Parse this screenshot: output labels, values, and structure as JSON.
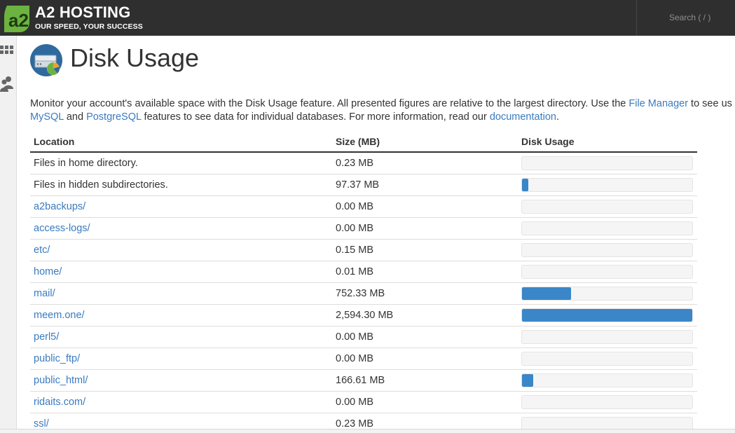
{
  "header": {
    "brand_mark": "a2",
    "brand_name": "A2 HOSTING",
    "tagline": "OUR SPEED, YOUR SUCCESS",
    "search_label": "Search ( / )",
    "brand_color": "#6cb33f"
  },
  "leftrail": {
    "items": [
      {
        "icon": "grid-icon"
      },
      {
        "icon": "users-icon"
      }
    ]
  },
  "page": {
    "icon": "disk-usage-icon",
    "title": "Disk Usage",
    "desc": {
      "p1": "Monitor your account's available space with the Disk Usage feature. All presented figures are relative to the largest directory. Use the ",
      "link1": "File Manager",
      "p2": " to see us",
      "link2": "MySQL",
      "p3": " and ",
      "link3": "PostgreSQL",
      "p4": " features to see data for individual databases. For more information, read our ",
      "link4": "documentation",
      "p5": "."
    }
  },
  "table": {
    "headers": {
      "location": "Location",
      "size": "Size (MB)",
      "usage": "Disk Usage"
    },
    "rows": [
      {
        "location": "Files in home directory.",
        "size": "0.23 MB",
        "usage_fraction": 0.0001,
        "link": false
      },
      {
        "location": "Files in hidden subdirectories.",
        "size": "97.37 MB",
        "usage_fraction": 0.0375,
        "link": false
      },
      {
        "location": "a2backups/",
        "size": "0.00 MB",
        "usage_fraction": 0,
        "link": true
      },
      {
        "location": "access-logs/",
        "size": "0.00 MB",
        "usage_fraction": 0,
        "link": true
      },
      {
        "location": "etc/",
        "size": "0.15 MB",
        "usage_fraction": 0.0001,
        "link": true
      },
      {
        "location": "home/",
        "size": "0.01 MB",
        "usage_fraction": 0,
        "link": true
      },
      {
        "location": "mail/",
        "size": "752.33 MB",
        "usage_fraction": 0.29,
        "link": true
      },
      {
        "location": "meem.one/",
        "size": "2,594.30 MB",
        "usage_fraction": 1.0,
        "link": true
      },
      {
        "location": "perl5/",
        "size": "0.00 MB",
        "usage_fraction": 0,
        "link": true
      },
      {
        "location": "public_ftp/",
        "size": "0.00 MB",
        "usage_fraction": 0,
        "link": true
      },
      {
        "location": "public_html/",
        "size": "166.61 MB",
        "usage_fraction": 0.0642,
        "link": true
      },
      {
        "location": "ridaits.com/",
        "size": "0.00 MB",
        "usage_fraction": 0,
        "link": true
      },
      {
        "location": "ssl/",
        "size": "0.23 MB",
        "usage_fraction": 0.0001,
        "link": true
      }
    ]
  }
}
